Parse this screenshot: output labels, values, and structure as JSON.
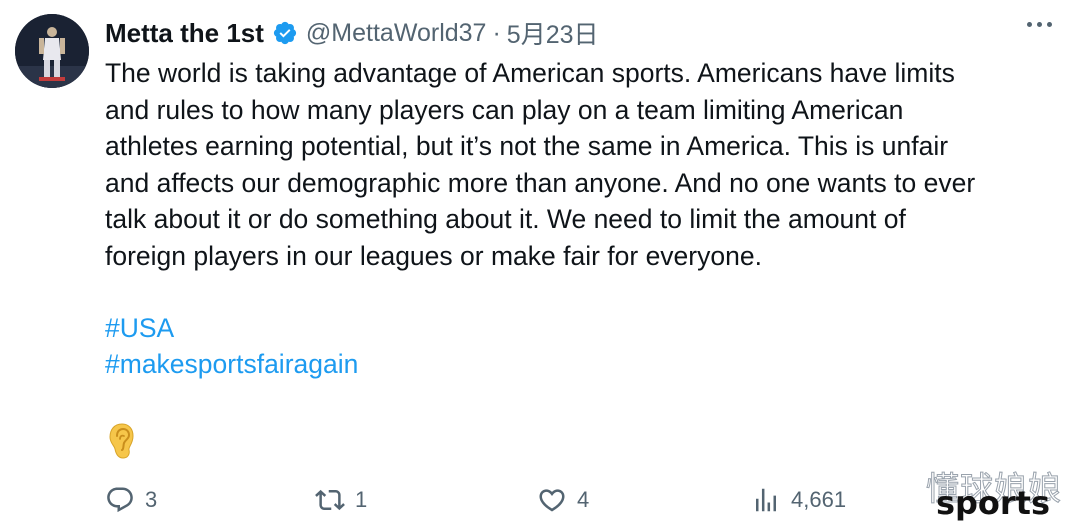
{
  "tweet": {
    "author": {
      "display_name": "Metta the 1st",
      "handle": "@MettaWorld37",
      "verified_icon": "verified-badge-icon",
      "avatar": "avatar"
    },
    "separator": "·",
    "date": "5月23日",
    "more_icon": "more-options-icon",
    "text_lines": [
      "The world is taking advantage of American sports. Americans have limits",
      "and rules to how many players can play on a team limiting American",
      "athletes earning potential, but it’s not the same in America. This is unfair",
      "and affects our demographic more than anyone. And no one wants to ever",
      "talk about it or do something about it. We need to limit the amount of",
      "foreign players in our leagues or make fair for everyone."
    ],
    "hashtags": [
      "#USA",
      "#makesportsfairagain"
    ],
    "emoji": "ear-emoji",
    "actions": {
      "reply": {
        "icon": "reply-icon",
        "count": "3"
      },
      "retweet": {
        "icon": "retweet-icon",
        "count": "1"
      },
      "like": {
        "icon": "heart-icon",
        "count": "4"
      },
      "views": {
        "icon": "views-chart-icon",
        "count": "4,661"
      }
    }
  },
  "watermark": {
    "chinese_text": "懂球娘娘",
    "english_text": "sports"
  },
  "colors": {
    "text": "#0f1419",
    "secondary": "#536471",
    "link": "#1d9bf0",
    "verified": "#1d9bf0"
  }
}
